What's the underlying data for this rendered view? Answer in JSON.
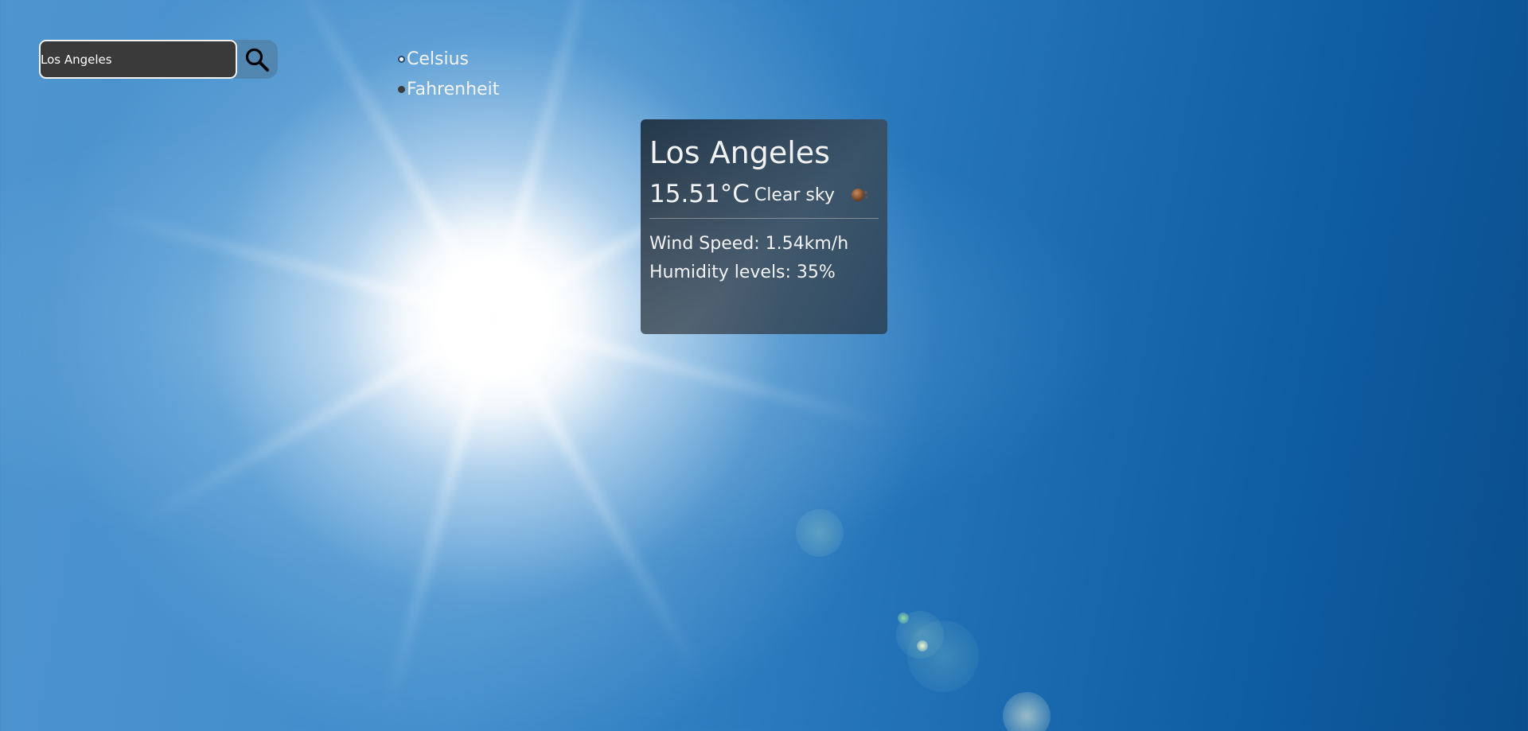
{
  "search": {
    "value": "Los Angeles",
    "button_icon": "search-icon"
  },
  "units": {
    "options": [
      {
        "label": "Celsius",
        "selected": false
      },
      {
        "label": "Fahrenheit",
        "selected": true
      }
    ]
  },
  "weather": {
    "city": "Los Angeles",
    "temperature": "15.51°C",
    "description": "Clear sky",
    "icon": "clear-sky-icon",
    "wind_speed": "Wind Speed: 1.54km/h",
    "humidity": "Humidity levels: 35%"
  }
}
